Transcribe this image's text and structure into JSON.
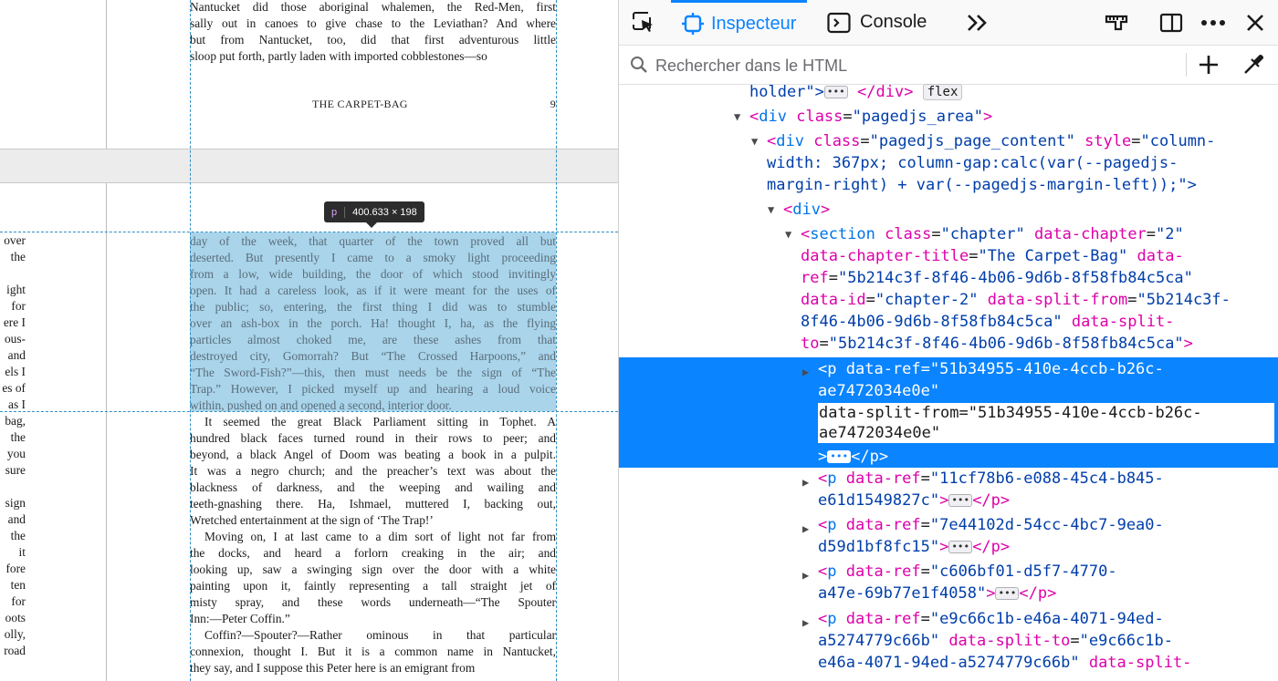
{
  "preview": {
    "top_paragraph": [
      "Nantucket did those aboriginal whalemen, the Red-Men, first",
      "sally out in canoes to give chase to the Leviathan? And where",
      "but from Nantucket, too, did that first adventurous little",
      "sloop put forth, partly laden with imported cobblestones—so"
    ],
    "running_header": {
      "title": "THE CARPET-BAG",
      "page_number": "9"
    },
    "tooltip": {
      "tag": "p",
      "size": "400.633 × 198"
    },
    "highlighted_paragraph": [
      "day of the week, that quarter of the town proved all but",
      "deserted. But presently I came to a smoky light proceeding",
      "from a low, wide building, the door of which stood invitingly",
      "open. It had a careless look, as if it were meant for the uses of",
      "the public; so, entering, the first thing I did was to stumble",
      "over an ash-box in the porch. Ha! thought I, ha, as the flying",
      "particles almost choked me, are these ashes from that",
      "destroyed city, Gomorrah? But “The Crossed Harpoons,” and",
      "“The Sword-Fish?”—this, then must needs be the sign of “The",
      "Trap.” However, I picked myself up and hearing a loud voice",
      "within, pushed on and opened a second, interior door."
    ],
    "paragraph_2": [
      "It seemed the great Black Parliament sitting in Tophet. A",
      "hundred black faces turned round in their rows to peer; and",
      "beyond, a black Angel of Doom was beating a book in a pulpit.",
      "It was a negro church; and the preacher’s text was about the",
      "blackness of darkness, and the weeping and wailing and",
      "teeth-gnashing there. Ha, Ishmael, muttered I, backing out,",
      "Wretched entertainment at the sign of ‘The Trap!’"
    ],
    "paragraph_3": [
      "Moving on, I at last came to a dim sort of light not far from",
      "the docks, and heard a forlorn creaking in the air; and",
      "looking up, saw a swinging sign over the door with a white",
      "painting upon it, faintly representing a tall straight jet of",
      "misty spray, and these words underneath—“The Spouter",
      "Inn:—Peter Coffin.”"
    ],
    "paragraph_4": [
      "Coffin?—Spouter?—Rather ominous in that particular",
      "connexion, thought I. But it is a common name in Nantucket,",
      "they say, and I suppose this Peter here is an emigrant from"
    ],
    "left_column_fragments": [
      "over",
      "the",
      "",
      "ight",
      "for",
      "ere I",
      "ous-",
      "and",
      "els I",
      "es of",
      "as I",
      "bag,",
      "the",
      "you",
      "sure",
      "",
      "sign",
      "and",
      "the",
      "it",
      "fore",
      "ten",
      "for",
      "oots",
      "olly,",
      "road"
    ]
  },
  "devtools": {
    "tabs": {
      "inspector": "Inspecteur",
      "console": "Console"
    },
    "search": {
      "placeholder": "Rechercher dans le HTML"
    },
    "tree": {
      "row0": {
        "text": "holder\">",
        "close": "</div>",
        "badge": "flex"
      },
      "row1": {
        "tag": "div",
        "attr": "class",
        "value": "\"pagedjs_area\""
      },
      "row2": {
        "l1_tag": "div",
        "l1_a1": "class",
        "l1_v1": "\"pagedjs_page_content\"",
        "l1_a2": "style",
        "l1_v2": "\"column-",
        "l2": "width: 367px; column-gap:calc(var(--pagedjs-",
        "l3": "margin-right) + var(--pagedjs-margin-left));\">"
      },
      "row3": {
        "tag": "div"
      },
      "row4": {
        "l1_tag": "section",
        "l1_a1": "class",
        "l1_v1": "\"chapter\"",
        "l1_a2": "data-chapter",
        "l1_v2": "\"2\"",
        "l2_a1": "data-chapter-title",
        "l2_v1": "\"The Carpet-Bag\"",
        "l2_a2": "data-",
        "l3_a1": "ref",
        "l3_v1": "\"5b214c3f-8f46-4b06-9d6b-8f58fb84c5ca\"",
        "l4_a1": "data-id",
        "l4_v1": "\"chapter-2\"",
        "l4_a2": "data-split-from",
        "l4_v2": "\"5b214c3f-",
        "l5_v1": "8f46-4b06-9d6b-8f58fb84c5ca\"",
        "l5_a2": "data-split-",
        "l6_a1": "to",
        "l6_v1": "\"5b214c3f-8f46-4b06-9d6b-8f58fb84c5ca\""
      },
      "selected": {
        "tag": "p",
        "a1": "data-ref",
        "v1": "\"51b34955-410e-4ccb-b26c-",
        "v1b": "ae7472034e0e\"",
        "edit_l1": "data-split-from=\"51b34955-410e-4ccb-b26c-",
        "edit_l2": "ae7472034e0e\"",
        "close": "</p>"
      },
      "row6": {
        "tag": "p",
        "a1": "data-ref",
        "v1": "\"11cf78b6-e088-45c4-b845-",
        "v1b": "e61d1549827c\"",
        "close": "</p>"
      },
      "row7": {
        "tag": "p",
        "a1": "data-ref",
        "v1": "\"7e44102d-54cc-4bc7-9ea0-",
        "v1b": "d59d1bf8fc15\"",
        "close": "</p>"
      },
      "row8": {
        "tag": "p",
        "a1": "data-ref",
        "v1": "\"c606bf01-d5f7-4770-",
        "v1b": "a47e-69b77e1f4058\"",
        "close": "</p>"
      },
      "row9": {
        "tag": "p",
        "a1": "data-ref",
        "v1": "\"e9c66c1b-e46a-4071-94ed-",
        "l2_v1": "a5274779c66b\"",
        "l2_a2": "data-split-to",
        "l2_v2": "\"e9c66c1b-",
        "l3_v1": "e46a-4071-94ed-a5274779c66b\"",
        "l3_a2": "data-split-"
      }
    },
    "colors": {
      "accent": "#0a84ff",
      "attr_name": "#dd00a9",
      "attr_value": "#003eaa",
      "tag_name": "#0074e8"
    }
  }
}
